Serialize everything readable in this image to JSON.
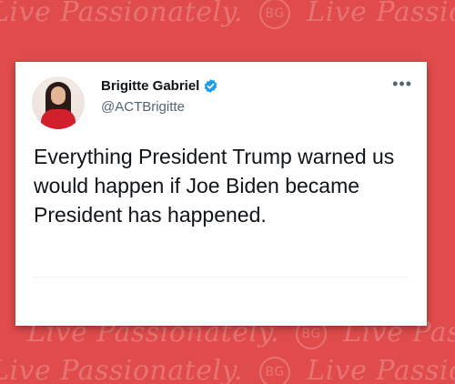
{
  "watermark": {
    "rows": [
      {
        "text1": "Live Passionately.",
        "mono": "BG",
        "text2": "Live Passionately."
      },
      {
        "text1": "Live Passionately.",
        "mono": "BG",
        "text2": "Live Passionately."
      },
      {
        "text1": "Live Passionately.",
        "mono": "BG",
        "text2": "Live Passionately."
      }
    ]
  },
  "tweet": {
    "author_name": "Brigitte Gabriel",
    "handle": "@ACTBrigitte",
    "more_label": "•••",
    "text": "Everything President Trump warned us would happen if Joe Biden became President has happened.",
    "verified_color": "#1d9bf0"
  },
  "colors": {
    "background": "#e04c4c",
    "card": "#ffffff"
  }
}
